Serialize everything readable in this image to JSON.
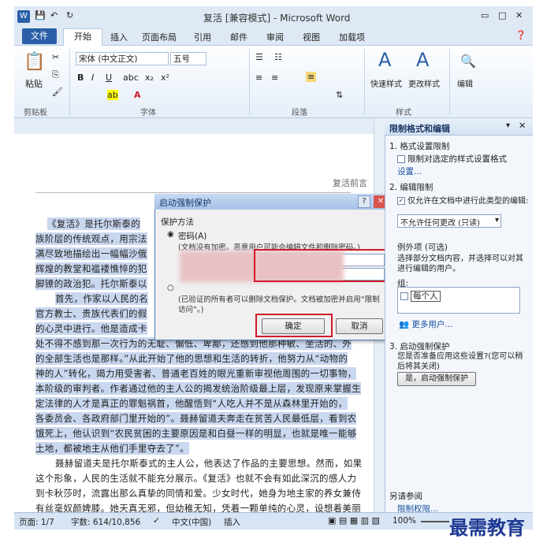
{
  "window": {
    "title": "复活 [兼容模式] - Microsoft Word"
  },
  "tabs": [
    "文件",
    "开始",
    "插入",
    "页面布局",
    "引用",
    "邮件",
    "审阅",
    "视图",
    "加载项"
  ],
  "ribbon": {
    "paste": "粘贴",
    "clipboard": "剪贴板",
    "font_name": "宋体 (中文正文)",
    "font_size": "五号",
    "font_group": "字体",
    "para_group": "段落",
    "style_group": "样式",
    "quick_style": "快速样式",
    "change_style": "更改样式",
    "edit": "编辑"
  },
  "document": {
    "header_text": "复活前言",
    "lines": [
      "《复活》是托尔斯泰的",
      "族阶层的传统观点，用宗法",
      "满尽致地描绘出一幅幅沙俄",
      "辉煌的教堂和褴褛憔悴的犯",
      "脚镣的政治犯。托尔斯泰以",
      "首先，作家以人民的名",
      "官方教士、贵族代表们的假",
      "的心灵中进行。他是造成卡",
      "处不得不感到那一次行为的无耻、偏低、卑鄙，还感到他那种敏、坐活的、外",
      "的全部生活也是那样。”从此开始了他的思想和生活的转折，他努力从“动物的",
      "神的人”转化，竭力用受害者、普通老百姓的眼光重新审视他周围的一切事物，",
      "本阶级的审判者。作者通过他的主人公的揭发统治阶级最上层，发现原来掌握生",
      "定法律的人才是真正的罪魁祸首，他醒悟到“人吃人并不是从森林里开始的，",
      "各委员会、各政府部门里开始的”。聂赫留道夫奔走在贫苦人民最低层，看到农",
      "饿死上，他认识到“农民贫困的主要原因是和白昼一样的明显，也就是唯一能够",
      "土地，都被地主从他们手里夺去了”。",
      "聂赫留道夫是托尔斯泰式的主人公，他表达了作品的主要思想。然而，如果",
      "这个形象，人民的生活就不能充分展示。《复活》也就不会有如此深沉的感人力",
      "到卡秋莎时，流露出那么真挚的同情和爱。少女时代，她身为地主家的养女兼侍",
      "有丝毫奴颜婢膝。她天真无邪，但幼稚无知，凭着一颗单纯的心灵，设想着美丽"
    ]
  },
  "dialog": {
    "title": "启动强制保护",
    "method_label": "保护方法",
    "password_option": "密码(A)",
    "password_desc": "(文档没有加密。恶意用户可能会编辑文件和删除密码。)",
    "auth_desc": "(已验证的所有者可以删除文档保护。文档被加密并启用“限制访问”。)",
    "ok": "确定",
    "cancel": "取消"
  },
  "pane": {
    "title": "限制格式和编辑",
    "s1": "1. 格式设置限制",
    "s1_check": "限制对选定的样式设置格式",
    "s1_link": "设置...",
    "s2": "2. 编辑限制",
    "s2_check": "仅允许在文档中进行此类型的编辑:",
    "s2_select": "不允许任何更改 (只读)",
    "exceptions": "例外项 (可选)",
    "exceptions_desc": "选择部分文档内容，并选择可以对其进行编辑的用户。",
    "groups": "组:",
    "everyone": "每个人",
    "more_users": "更多用户...",
    "s3": "3. 启动强制保护",
    "s3_desc": "您是否准备应用这些设置?(您可以稍后将其关闭)",
    "s3_btn": "是，启动强制保护",
    "see_also": "另请参阅",
    "permission": "限制权限..."
  },
  "status": {
    "page": "页面: 1/7",
    "words": "字数: 614/10,856",
    "lang": "中文(中国)",
    "mode": "插入",
    "zoom": "100%"
  },
  "watermark": "最需教育"
}
